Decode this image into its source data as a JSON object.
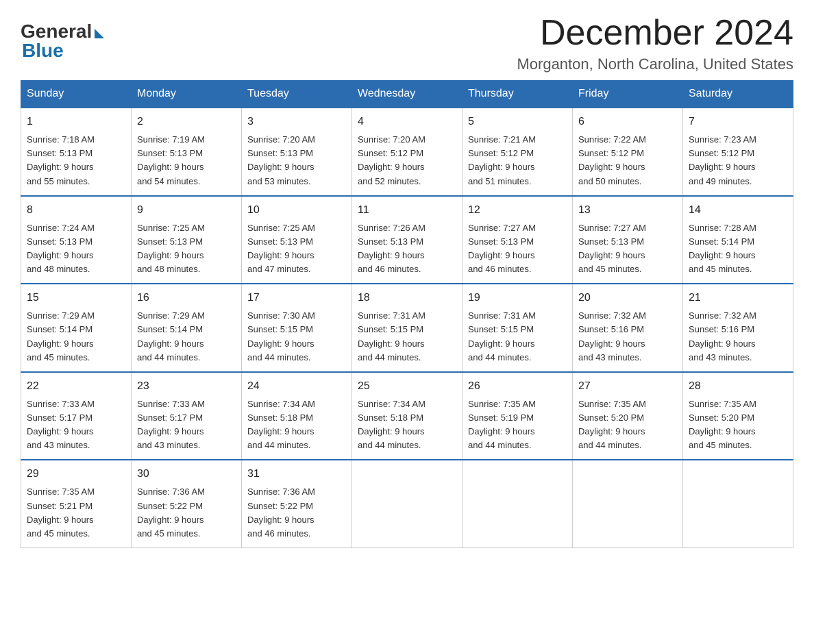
{
  "header": {
    "logo_general": "General",
    "logo_blue": "Blue",
    "month_title": "December 2024",
    "location": "Morganton, North Carolina, United States"
  },
  "days_of_week": [
    "Sunday",
    "Monday",
    "Tuesday",
    "Wednesday",
    "Thursday",
    "Friday",
    "Saturday"
  ],
  "weeks": [
    [
      {
        "day": "1",
        "sunrise": "7:18 AM",
        "sunset": "5:13 PM",
        "daylight": "9 hours and 55 minutes."
      },
      {
        "day": "2",
        "sunrise": "7:19 AM",
        "sunset": "5:13 PM",
        "daylight": "9 hours and 54 minutes."
      },
      {
        "day": "3",
        "sunrise": "7:20 AM",
        "sunset": "5:13 PM",
        "daylight": "9 hours and 53 minutes."
      },
      {
        "day": "4",
        "sunrise": "7:20 AM",
        "sunset": "5:12 PM",
        "daylight": "9 hours and 52 minutes."
      },
      {
        "day": "5",
        "sunrise": "7:21 AM",
        "sunset": "5:12 PM",
        "daylight": "9 hours and 51 minutes."
      },
      {
        "day": "6",
        "sunrise": "7:22 AM",
        "sunset": "5:12 PM",
        "daylight": "9 hours and 50 minutes."
      },
      {
        "day": "7",
        "sunrise": "7:23 AM",
        "sunset": "5:12 PM",
        "daylight": "9 hours and 49 minutes."
      }
    ],
    [
      {
        "day": "8",
        "sunrise": "7:24 AM",
        "sunset": "5:13 PM",
        "daylight": "9 hours and 48 minutes."
      },
      {
        "day": "9",
        "sunrise": "7:25 AM",
        "sunset": "5:13 PM",
        "daylight": "9 hours and 48 minutes."
      },
      {
        "day": "10",
        "sunrise": "7:25 AM",
        "sunset": "5:13 PM",
        "daylight": "9 hours and 47 minutes."
      },
      {
        "day": "11",
        "sunrise": "7:26 AM",
        "sunset": "5:13 PM",
        "daylight": "9 hours and 46 minutes."
      },
      {
        "day": "12",
        "sunrise": "7:27 AM",
        "sunset": "5:13 PM",
        "daylight": "9 hours and 46 minutes."
      },
      {
        "day": "13",
        "sunrise": "7:27 AM",
        "sunset": "5:13 PM",
        "daylight": "9 hours and 45 minutes."
      },
      {
        "day": "14",
        "sunrise": "7:28 AM",
        "sunset": "5:14 PM",
        "daylight": "9 hours and 45 minutes."
      }
    ],
    [
      {
        "day": "15",
        "sunrise": "7:29 AM",
        "sunset": "5:14 PM",
        "daylight": "9 hours and 45 minutes."
      },
      {
        "day": "16",
        "sunrise": "7:29 AM",
        "sunset": "5:14 PM",
        "daylight": "9 hours and 44 minutes."
      },
      {
        "day": "17",
        "sunrise": "7:30 AM",
        "sunset": "5:15 PM",
        "daylight": "9 hours and 44 minutes."
      },
      {
        "day": "18",
        "sunrise": "7:31 AM",
        "sunset": "5:15 PM",
        "daylight": "9 hours and 44 minutes."
      },
      {
        "day": "19",
        "sunrise": "7:31 AM",
        "sunset": "5:15 PM",
        "daylight": "9 hours and 44 minutes."
      },
      {
        "day": "20",
        "sunrise": "7:32 AM",
        "sunset": "5:16 PM",
        "daylight": "9 hours and 43 minutes."
      },
      {
        "day": "21",
        "sunrise": "7:32 AM",
        "sunset": "5:16 PM",
        "daylight": "9 hours and 43 minutes."
      }
    ],
    [
      {
        "day": "22",
        "sunrise": "7:33 AM",
        "sunset": "5:17 PM",
        "daylight": "9 hours and 43 minutes."
      },
      {
        "day": "23",
        "sunrise": "7:33 AM",
        "sunset": "5:17 PM",
        "daylight": "9 hours and 43 minutes."
      },
      {
        "day": "24",
        "sunrise": "7:34 AM",
        "sunset": "5:18 PM",
        "daylight": "9 hours and 44 minutes."
      },
      {
        "day": "25",
        "sunrise": "7:34 AM",
        "sunset": "5:18 PM",
        "daylight": "9 hours and 44 minutes."
      },
      {
        "day": "26",
        "sunrise": "7:35 AM",
        "sunset": "5:19 PM",
        "daylight": "9 hours and 44 minutes."
      },
      {
        "day": "27",
        "sunrise": "7:35 AM",
        "sunset": "5:20 PM",
        "daylight": "9 hours and 44 minutes."
      },
      {
        "day": "28",
        "sunrise": "7:35 AM",
        "sunset": "5:20 PM",
        "daylight": "9 hours and 45 minutes."
      }
    ],
    [
      {
        "day": "29",
        "sunrise": "7:35 AM",
        "sunset": "5:21 PM",
        "daylight": "9 hours and 45 minutes."
      },
      {
        "day": "30",
        "sunrise": "7:36 AM",
        "sunset": "5:22 PM",
        "daylight": "9 hours and 45 minutes."
      },
      {
        "day": "31",
        "sunrise": "7:36 AM",
        "sunset": "5:22 PM",
        "daylight": "9 hours and 46 minutes."
      },
      null,
      null,
      null,
      null
    ]
  ]
}
